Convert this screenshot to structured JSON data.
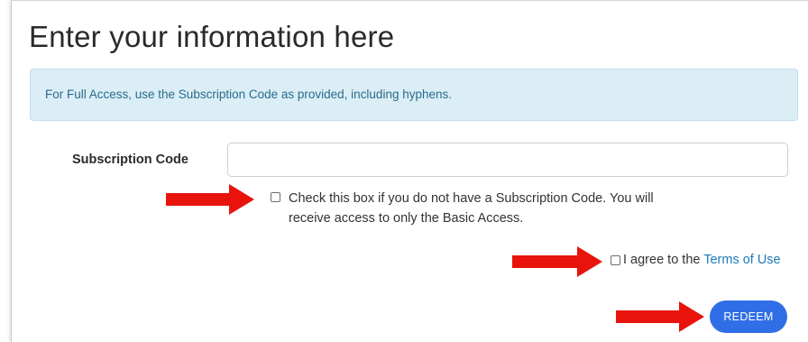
{
  "page": {
    "title": "Enter your information here"
  },
  "info_banner": {
    "text": "For Full Access, use the Subscription Code as provided, including hyphens."
  },
  "subscription_field": {
    "label": "Subscription Code",
    "value": "",
    "placeholder": ""
  },
  "no_code_checkbox": {
    "checked": false,
    "line1": "Check this box if you do not have a Subscription Code. You will",
    "line2": "receive access to only the Basic Access."
  },
  "terms_checkbox": {
    "checked": false,
    "prefix": "I agree to the ",
    "link_text": "Terms of Use"
  },
  "redeem_button": {
    "label": "REDEEM"
  },
  "colors": {
    "banner_bg": "#dbeef6",
    "banner_text": "#2a6b8c",
    "link": "#1f7ab8",
    "button_bg": "#2f6ee6",
    "annotation_arrow": "#e8140c"
  },
  "annotations": {
    "arrow_icon": "red-right-arrow-icon"
  }
}
